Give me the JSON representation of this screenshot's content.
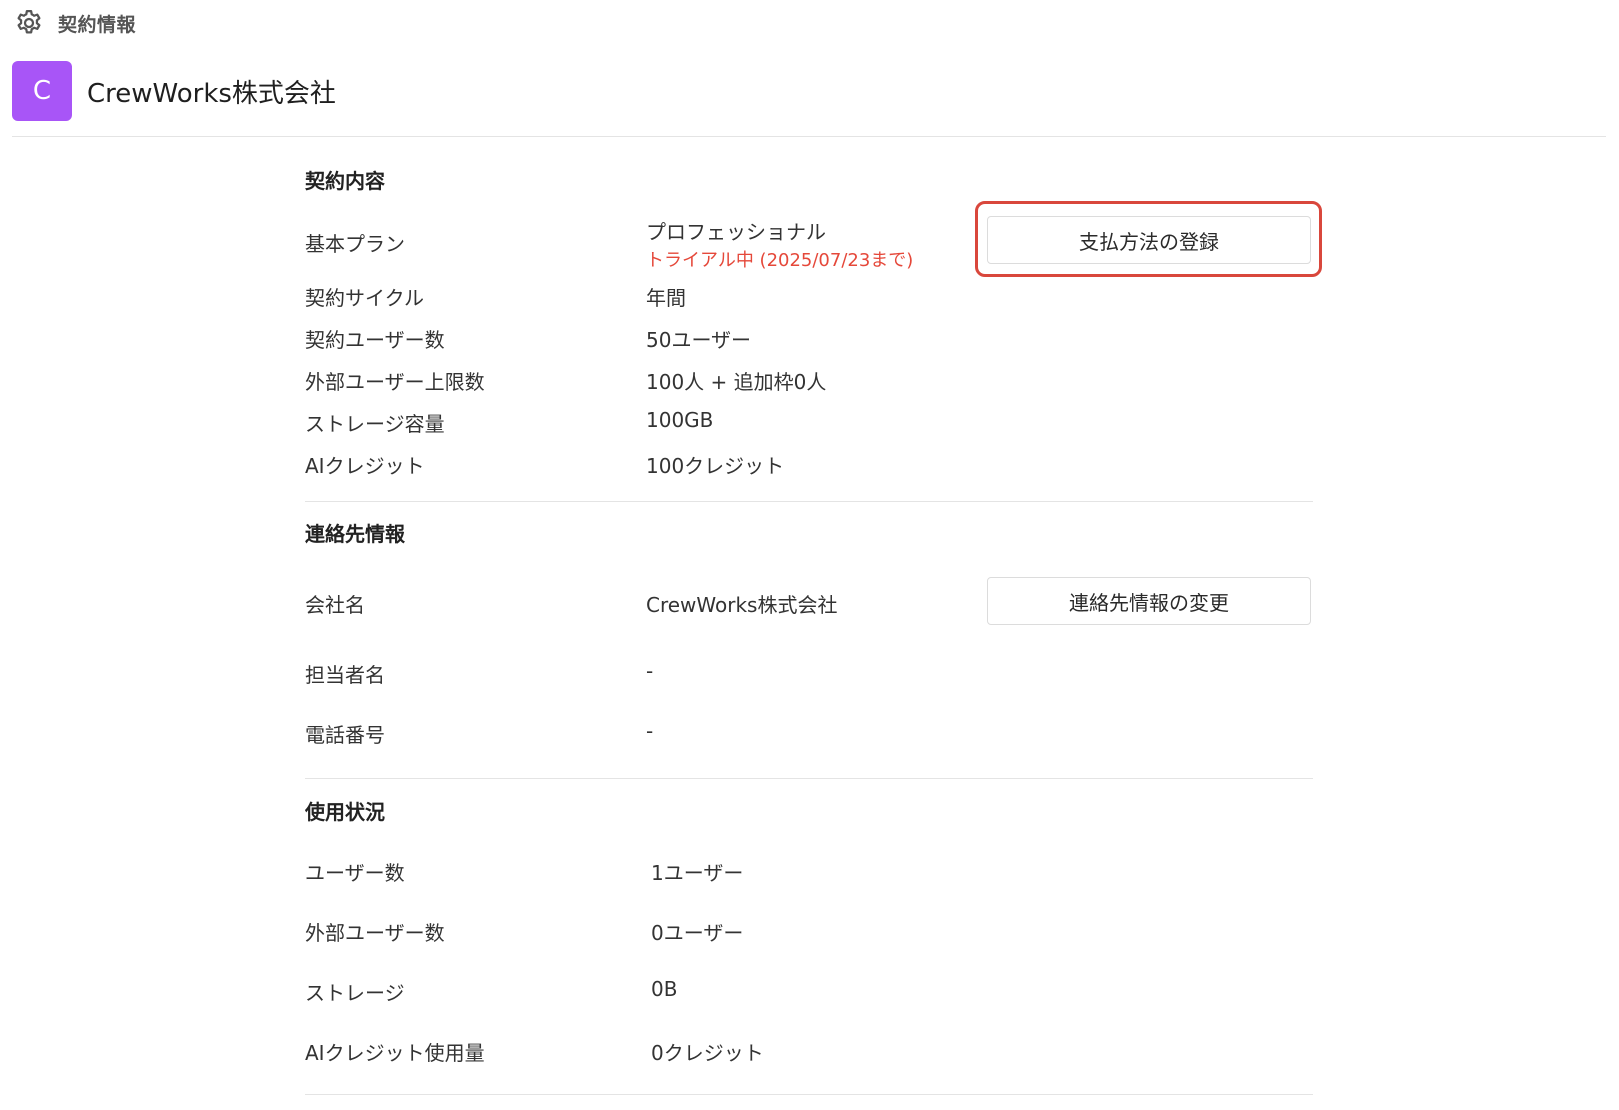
{
  "header": {
    "title": "契約情報",
    "icon": "gear-icon"
  },
  "org": {
    "avatar_letter": "C",
    "avatar_color": "#a855f7",
    "name": "CrewWorks株式会社"
  },
  "contract": {
    "title": "契約内容",
    "plan_label": "基本プラン",
    "plan_value": "プロフェッショナル",
    "trial_status": "トライアル中 (2025/07/23まで)",
    "trial_color": "#e5483a",
    "payment_button": "支払方法の登録",
    "highlight_color": "#d9473c",
    "rows": [
      {
        "label": "契約サイクル",
        "value": "年間"
      },
      {
        "label": "契約ユーザー数",
        "value": "50ユーザー"
      },
      {
        "label": "外部ユーザー上限数",
        "value": "100人 + 追加枠0人"
      },
      {
        "label": "ストレージ容量",
        "value": "100GB"
      },
      {
        "label": "AIクレジット",
        "value": "100クレジット"
      }
    ]
  },
  "contact": {
    "title": "連絡先情報",
    "change_button": "連絡先情報の変更",
    "rows": [
      {
        "label": "会社名",
        "value": "CrewWorks株式会社"
      },
      {
        "label": "担当者名",
        "value": "-"
      },
      {
        "label": "電話番号",
        "value": "-"
      }
    ]
  },
  "usage": {
    "title": "使用状況",
    "rows": [
      {
        "label": "ユーザー数",
        "value": "1ユーザー"
      },
      {
        "label": "外部ユーザー数",
        "value": "0ユーザー"
      },
      {
        "label": "ストレージ",
        "value": "0B"
      },
      {
        "label": "AIクレジット使用量",
        "value": "0クレジット"
      }
    ]
  }
}
